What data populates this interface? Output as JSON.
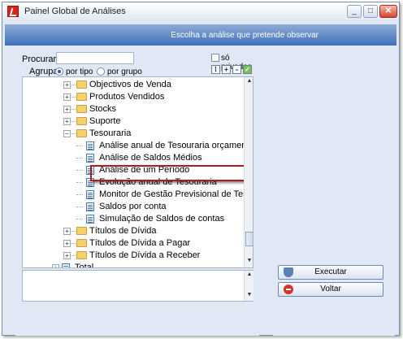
{
  "window": {
    "title": "Painel Global de Análises"
  },
  "header": {
    "text": "Escolha a análise que pretende observar"
  },
  "search": {
    "label": "Procurar :",
    "value": ""
  },
  "filter": {
    "only_private_label": "só privadas",
    "checked": false
  },
  "grouping": {
    "label": "Agrupar:",
    "options": [
      "por tipo",
      "por grupo"
    ],
    "selected": "por tipo"
  },
  "tree": {
    "items": [
      {
        "label": "Objectivos de Venda",
        "type": "folder",
        "level": 1,
        "expanded": false
      },
      {
        "label": "Produtos Vendidos",
        "type": "folder",
        "level": 1,
        "expanded": false
      },
      {
        "label": "Stocks",
        "type": "folder",
        "level": 1,
        "expanded": false
      },
      {
        "label": "Suporte",
        "type": "folder",
        "level": 1,
        "expanded": false
      },
      {
        "label": "Tesouraria",
        "type": "folder",
        "level": 1,
        "expanded": true
      },
      {
        "label": "Análise anual de Tesouraria orçamental",
        "type": "report",
        "level": 2,
        "selected": true
      },
      {
        "label": "Análise de Saldos Médios",
        "type": "report",
        "level": 2
      },
      {
        "label": "Análise de um Período",
        "type": "report",
        "level": 2
      },
      {
        "label": "Evolução anual de Tesouraria",
        "type": "report",
        "level": 2
      },
      {
        "label": "Monitor de Gestão Previsional de Tesouraria",
        "type": "report",
        "level": 2
      },
      {
        "label": "Saldos por conta",
        "type": "report",
        "level": 2
      },
      {
        "label": "Simulação de Saldos de contas",
        "type": "report",
        "level": 2
      },
      {
        "label": "Títulos de Dívida",
        "type": "folder",
        "level": 1,
        "expanded": false
      },
      {
        "label": "Títulos de Dívida a Pagar",
        "type": "folder",
        "level": 1,
        "expanded": false
      },
      {
        "label": "Títulos de Dívida a Receber",
        "type": "folder",
        "level": 1,
        "expanded": false
      },
      {
        "label": "Total",
        "type": "report",
        "level": 0,
        "expanded": false
      }
    ]
  },
  "buttons": {
    "run": "Executar",
    "back": "Voltar"
  },
  "colors": {
    "header": "#3f71b9",
    "highlight": "#b51a1a",
    "panel": "#dfe8f4"
  }
}
